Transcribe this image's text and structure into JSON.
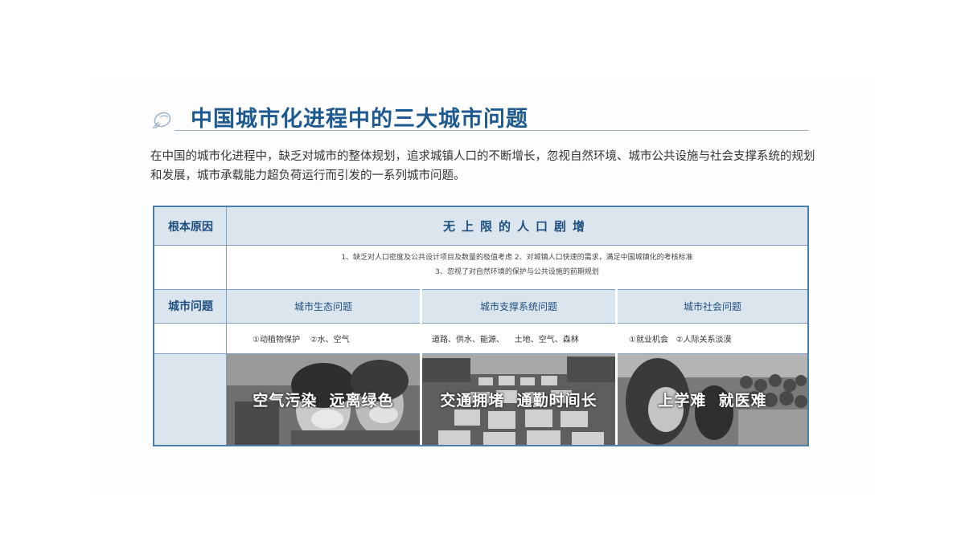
{
  "title": "中国城市化进程中的三大城市问题",
  "intro": "在中国的城市化进程中，缺乏对城市的整体规划，追求城镇人口的不断增长，忽视自然环境、城市公共设施与社会支撑系统的规划和发展，城市承载能力超负荷运行而引发的一系列城市问题。",
  "table": {
    "root_cause_label": "根本原因",
    "root_cause_title": "无上限的人口剧增",
    "reasons": [
      "1、缺乏对人口密度及公共设计项目及数量的极值考虑  2、对城镇人口快速的需求，满足中国城镇化的考核标准",
      "3、忽视了对自然环境的保护与公共设施的前期规划"
    ],
    "problems_label": "城市问题",
    "categories": [
      {
        "label": "城市生态问题",
        "items": "①动植物保护    ②水、空气",
        "caption": "空气污染  远离绿色"
      },
      {
        "label": "城市支撑系统问题",
        "items": "道路、供水、能源、    土地、空气、森林",
        "caption": "交通拥堵  通勤时间长"
      },
      {
        "label": "城市社会问题",
        "items": "①就业机会   ②人际关系淡漠",
        "caption": "上学难  就医难"
      }
    ]
  },
  "colors": {
    "accent": "#1e5a8f",
    "border": "#4d7ea8",
    "header_bg": "#dbe5ee"
  },
  "icons": {
    "title": "pen-nib-icon"
  }
}
